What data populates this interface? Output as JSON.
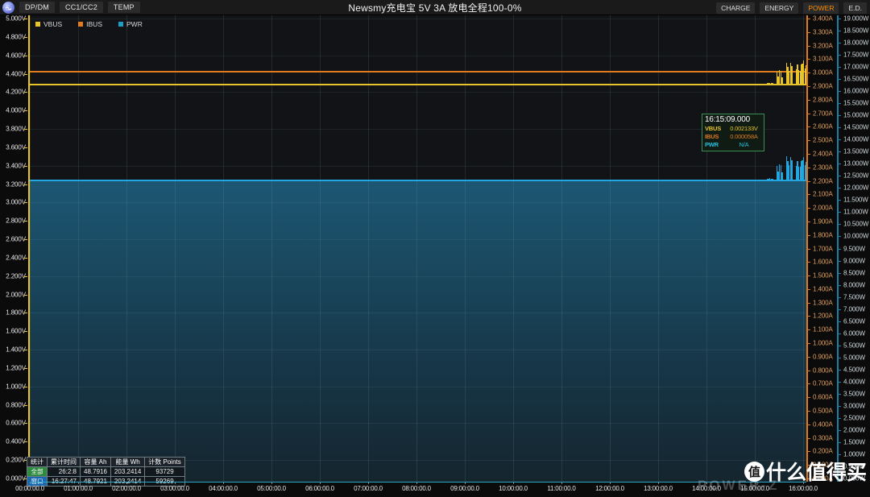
{
  "window": {
    "title": "Newsmy充电宝 5V 3A 放电全程100-0%",
    "app_icon": "wave-icon"
  },
  "header": {
    "left_tabs": [
      {
        "label": "DP/DM"
      },
      {
        "label": "CC1/CC2"
      },
      {
        "label": "TEMP"
      }
    ],
    "right_tabs": [
      {
        "label": "CHARGE",
        "active": false
      },
      {
        "label": "ENERGY",
        "active": false
      },
      {
        "label": "POWER",
        "active": true
      },
      {
        "label": "E.D.",
        "active": false
      }
    ]
  },
  "legend": [
    {
      "label": "VBUS",
      "color": "#e8c42a"
    },
    {
      "label": "IBUS",
      "color": "#e07b1e"
    },
    {
      "label": "PWR",
      "color": "#1a9ec4"
    }
  ],
  "readout": {
    "time": "16:15:09.000",
    "rows": [
      {
        "key": "VBUS",
        "value": "0.002133V",
        "color": "#e8c42a"
      },
      {
        "key": "IBUS",
        "value": "0.000058A",
        "color": "#e07b1e"
      },
      {
        "key": "PWR",
        "value": "N/A",
        "color": "#22c1e0"
      }
    ]
  },
  "stats": {
    "headers": [
      "统计",
      "累计时间",
      "容量 Ah",
      "能量 Wh",
      "计数 Points"
    ],
    "rows": [
      {
        "tag": "全部",
        "tag_style": "all",
        "time": "26:2:8",
        "capacity": "48.7916",
        "energy": "203.2414",
        "points": "93729"
      },
      {
        "tag": "窗口",
        "tag_style": "window",
        "time": "16:27:47",
        "capacity": "48.7921",
        "energy": "203.2414",
        "points": "59269"
      }
    ]
  },
  "watermark": {
    "brand": "POWER-Z",
    "smzdm_mark": "值",
    "smzdm_text": "什么值得买"
  },
  "chart_data": {
    "type": "line",
    "title": "Newsmy充电宝 5V 3A 放电全程100-0%",
    "xlabel": "",
    "grid": true,
    "legend_position": "top-left",
    "x_ticks": [
      "00:00:00.0",
      "01:00:00.0",
      "02:00:00.0",
      "03:00:00.0",
      "04:00:00.0",
      "05:00:00.0",
      "06:00:00.0",
      "07:00:00.0",
      "08:00:00.0",
      "09:00:00.0",
      "10:00:00.0",
      "11:00:00.0",
      "12:00:00.0",
      "13:00:00.0",
      "14:00:00.0",
      "15:00:00.0",
      "16:00:00.0"
    ],
    "xlim_hours": [
      0,
      16.0
    ],
    "axes": [
      {
        "id": "voltage",
        "side": "left",
        "unit": "V",
        "color": "#e8c42a",
        "ylim": [
          0.0,
          5.0
        ],
        "step": 0.2,
        "ticks": [
          "5.000V",
          "4.800V",
          "4.600V",
          "4.400V",
          "4.200V",
          "4.000V",
          "3.800V",
          "3.600V",
          "3.400V",
          "3.200V",
          "3.000V",
          "2.800V",
          "2.600V",
          "2.400V",
          "2.200V",
          "2.000V",
          "1.800V",
          "1.600V",
          "1.400V",
          "1.200V",
          "1.000V",
          "0.800V",
          "0.600V",
          "0.400V",
          "0.200V",
          "0.000V"
        ]
      },
      {
        "id": "current",
        "side": "right-inner",
        "unit": "A",
        "color": "#e07b1e",
        "ylim": [
          0.0,
          3.4
        ],
        "step": 0.1,
        "ticks": [
          "3.400A",
          "3.300A",
          "3.200A",
          "3.100A",
          "3.000A",
          "2.900A",
          "2.800A",
          "2.700A",
          "2.600A",
          "2.500A",
          "2.400A",
          "2.300A",
          "2.200A",
          "2.100A",
          "2.000A",
          "1.900A",
          "1.800A",
          "1.700A",
          "1.600A",
          "1.500A",
          "1.400A",
          "1.300A",
          "1.200A",
          "1.100A",
          "1.000A",
          "0.900A",
          "0.800A",
          "0.700A",
          "0.600A",
          "0.500A",
          "0.400A",
          "0.300A",
          "0.200A",
          "0.100A",
          "0.000A"
        ]
      },
      {
        "id": "power",
        "side": "right-outer",
        "unit": "W",
        "color": "#1c7fa8",
        "ylim": [
          0.0,
          19.0
        ],
        "step": 0.5,
        "ticks": [
          "19.000W",
          "18.500W",
          "18.000W",
          "17.500W",
          "17.000W",
          "16.500W",
          "16.000W",
          "15.500W",
          "15.000W",
          "14.500W",
          "14.000W",
          "13.500W",
          "13.000W",
          "12.500W",
          "12.000W",
          "11.500W",
          "11.000W",
          "10.500W",
          "10.000W",
          "9.500W",
          "9.000W",
          "8.500W",
          "8.000W",
          "7.500W",
          "7.000W",
          "6.500W",
          "6.000W",
          "5.500W",
          "5.000W",
          "4.500W",
          "4.000W",
          "3.500W",
          "3.000W",
          "2.500W",
          "2.000W",
          "1.500W",
          "1.000W",
          "0.500W",
          "0.000W"
        ]
      }
    ],
    "series": [
      {
        "name": "VBUS",
        "axis": "voltage",
        "color": "#e8c42a",
        "unit": "V",
        "steady_value": 4.29,
        "note": "Flat at ~4.29V for the whole run, with noise spikes at ~15.5-16.1h up to ~4.55V",
        "points": [
          {
            "t": 0.0,
            "v": 4.29
          },
          {
            "t": 2.0,
            "v": 4.29
          },
          {
            "t": 4.0,
            "v": 4.29
          },
          {
            "t": 6.0,
            "v": 4.29
          },
          {
            "t": 8.0,
            "v": 4.29
          },
          {
            "t": 10.0,
            "v": 4.29
          },
          {
            "t": 12.0,
            "v": 4.29
          },
          {
            "t": 14.0,
            "v": 4.29
          },
          {
            "t": 15.3,
            "v": 4.29
          },
          {
            "t": 15.5,
            "v": 4.45
          },
          {
            "t": 15.7,
            "v": 4.52
          },
          {
            "t": 15.9,
            "v": 4.5
          },
          {
            "t": 16.0,
            "v": 4.55
          }
        ]
      },
      {
        "name": "IBUS",
        "axis": "current",
        "color": "#e07b1e",
        "unit": "A",
        "steady_value": 3.01,
        "note": "Flat near top of current axis (~3.01A equivalent trace position) across whole capture",
        "points": [
          {
            "t": 0.0,
            "v": 3.01
          },
          {
            "t": 4.0,
            "v": 3.01
          },
          {
            "t": 8.0,
            "v": 3.01
          },
          {
            "t": 12.0,
            "v": 3.01
          },
          {
            "t": 16.0,
            "v": 3.01
          }
        ]
      },
      {
        "name": "PWR",
        "axis": "power",
        "color": "#22a7e0",
        "unit": "W",
        "steady_value": 12.35,
        "note": "Flat ~12.35W, filled area below; spikes up to ~13.3W near 15.5-16.1h",
        "points": [
          {
            "t": 0.0,
            "v": 12.35
          },
          {
            "t": 2.0,
            "v": 12.35
          },
          {
            "t": 4.0,
            "v": 12.35
          },
          {
            "t": 6.0,
            "v": 12.35
          },
          {
            "t": 8.0,
            "v": 12.35
          },
          {
            "t": 10.0,
            "v": 12.35
          },
          {
            "t": 12.0,
            "v": 12.35
          },
          {
            "t": 14.0,
            "v": 12.35
          },
          {
            "t": 15.3,
            "v": 12.4
          },
          {
            "t": 15.5,
            "v": 13.0
          },
          {
            "t": 15.7,
            "v": 13.3
          },
          {
            "t": 15.9,
            "v": 13.1
          },
          {
            "t": 16.0,
            "v": 13.3
          }
        ]
      }
    ]
  }
}
